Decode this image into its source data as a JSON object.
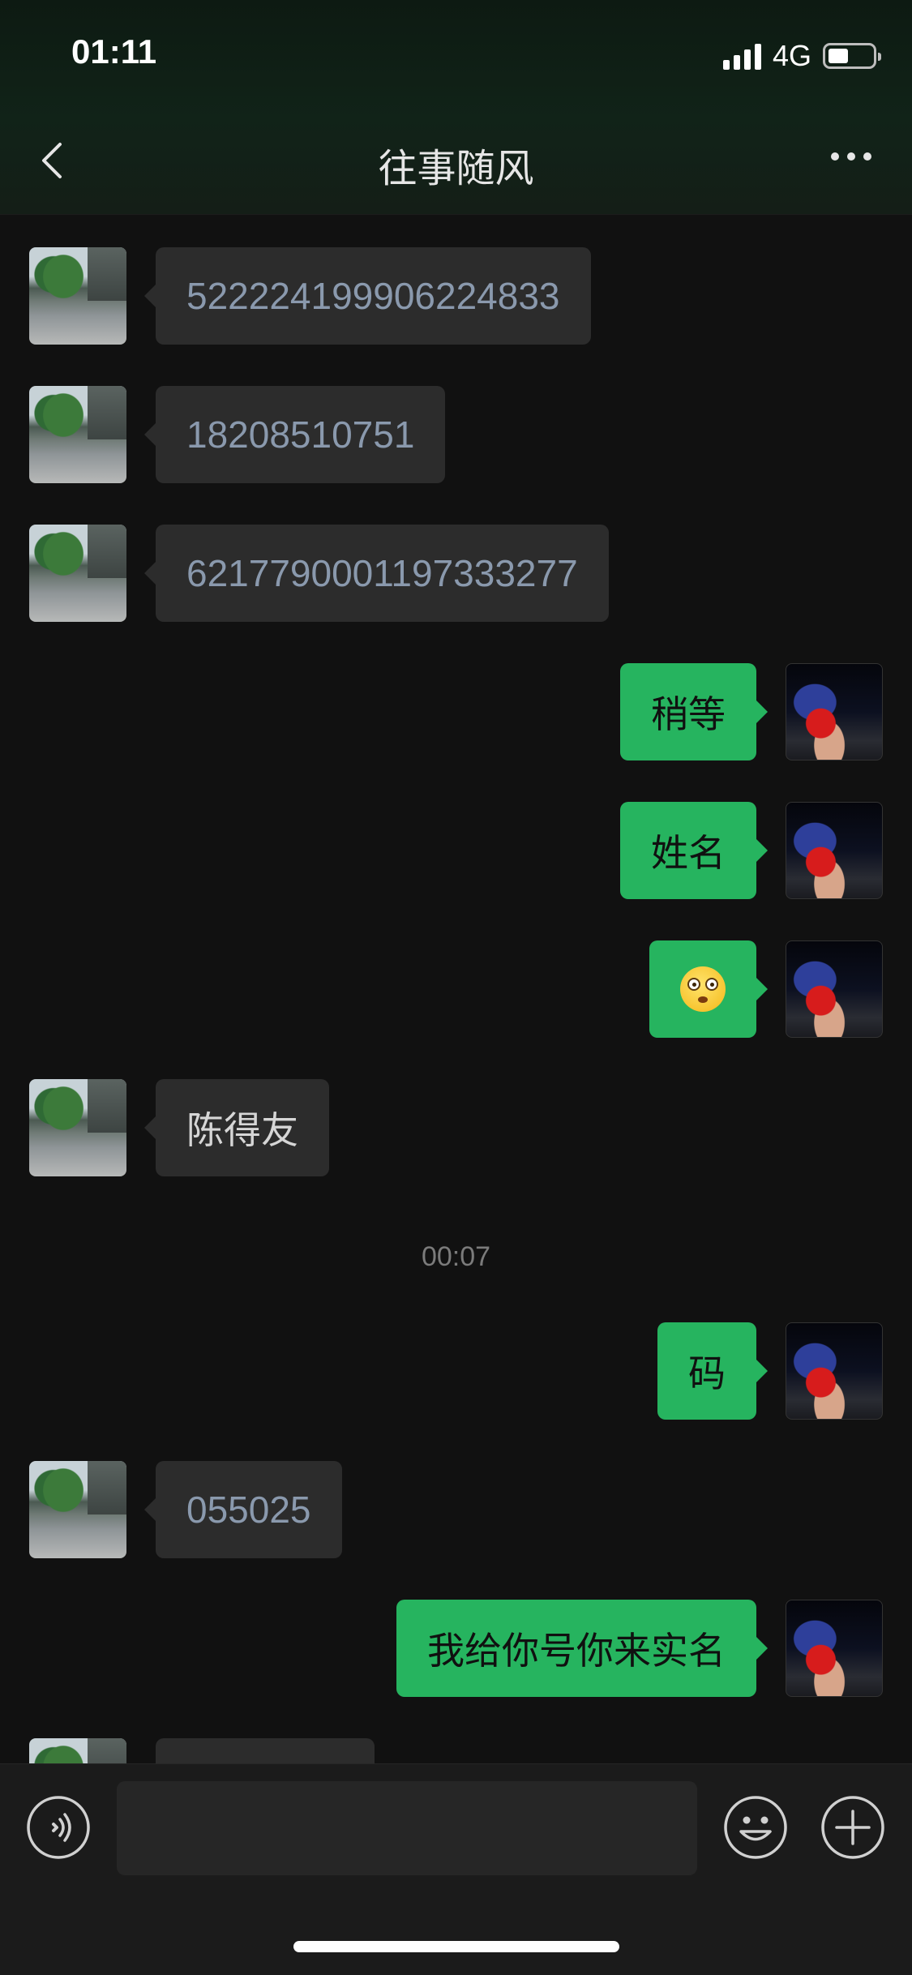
{
  "status_bar": {
    "time": "01:11",
    "network": "4G",
    "battery_level": 0.45
  },
  "header": {
    "title": "往事随风",
    "back_icon": "chevron-left-icon",
    "more_icon": "more-dots-icon"
  },
  "messages": [
    {
      "direction": "in",
      "type": "text",
      "text": "522224199906224833"
    },
    {
      "direction": "in",
      "type": "text",
      "text": "18208510751"
    },
    {
      "direction": "in",
      "type": "text",
      "text": "6217790001197333277"
    },
    {
      "direction": "out",
      "type": "text",
      "text": "稍等"
    },
    {
      "direction": "out",
      "type": "text",
      "text": "姓名"
    },
    {
      "direction": "out",
      "type": "emoji",
      "emoji": "flushed-face-emoji"
    },
    {
      "direction": "in",
      "type": "text",
      "text": "陈得友"
    },
    {
      "type": "timestamp",
      "text": "00:07"
    },
    {
      "direction": "out",
      "type": "text",
      "text": "码"
    },
    {
      "direction": "in",
      "type": "text",
      "text": "055025"
    },
    {
      "direction": "out",
      "type": "text",
      "text": "我给你号你来实名"
    }
  ],
  "input_bar": {
    "voice_icon": "voice-icon",
    "text_value": "",
    "emoji_icon": "emoji-icon",
    "plus_icon": "plus-icon"
  },
  "colors": {
    "background": "#111111",
    "incoming_bubble": "#2c2c2c",
    "outgoing_bubble": "#26b45f",
    "number_text": "#8a99ad",
    "timestamp_text": "#7b7b7b"
  }
}
